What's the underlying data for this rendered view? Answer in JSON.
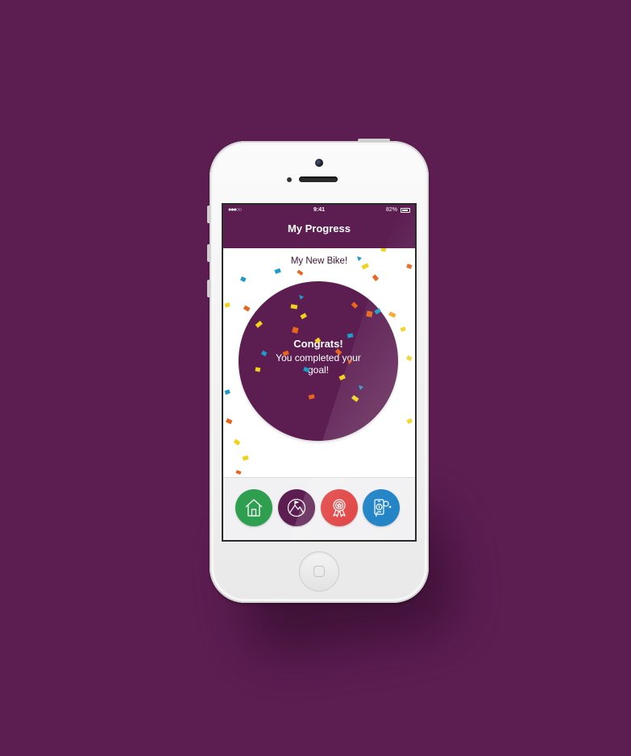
{
  "status_bar": {
    "signal": "●●●○○",
    "time": "9:41",
    "battery": "82%"
  },
  "header": {
    "title": "My Progress"
  },
  "goal": {
    "name": "My New Bike!",
    "congrats_title": "Congrats!",
    "congrats_message": "You completed your goal!"
  },
  "nav": {
    "items": [
      {
        "icon": "home-icon",
        "color": "#2e9e4f"
      },
      {
        "icon": "mountain-goal-icon",
        "color": "#5c1d51"
      },
      {
        "icon": "award-ribbon-icon",
        "color": "#e03c3c"
      },
      {
        "icon": "mobile-payment-icon",
        "color": "#1a80c4"
      }
    ]
  },
  "colors": {
    "background": "#5c1d51",
    "brand_purple": "#5c1d51",
    "confetti": [
      "#f5a623",
      "#1c9cc6",
      "#f0d21a",
      "#e8661c"
    ]
  }
}
